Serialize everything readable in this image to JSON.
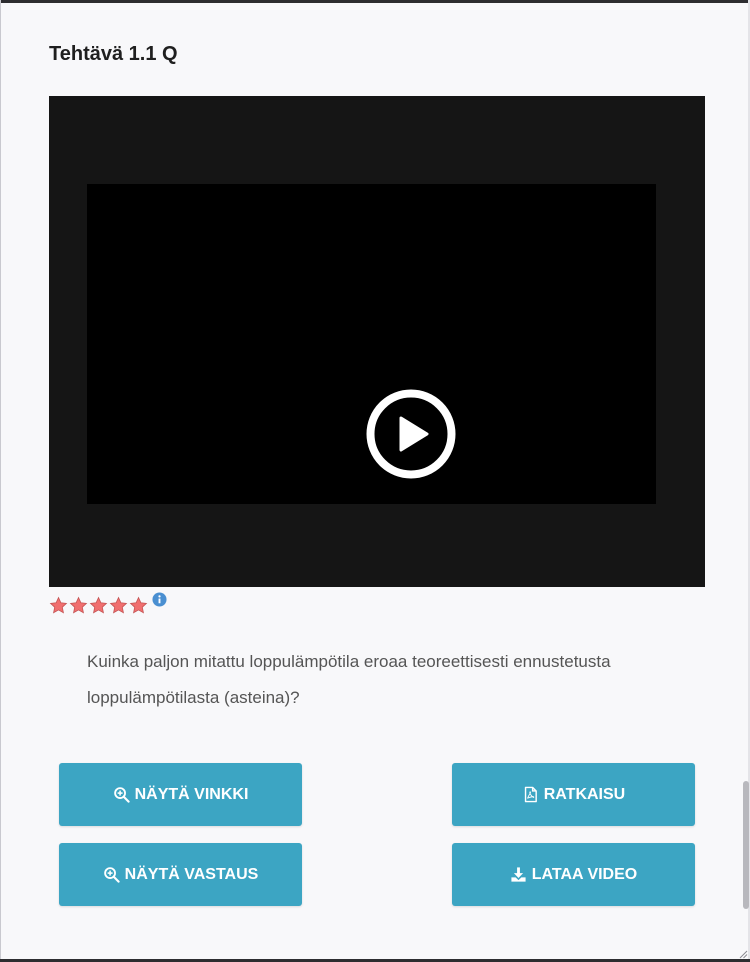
{
  "exercise": {
    "title": "Tehtävä 1.1 Q"
  },
  "video": {
    "play_icon": "play-circle-icon",
    "background_color": "#151515"
  },
  "rating": {
    "stars": 5,
    "max_stars": 5,
    "star_color": "#f06f6f",
    "info_icon": "info-icon"
  },
  "question": {
    "text": "Kuinka paljon mitattu loppulämpötila eroaa teoreettisesti ennustetusta loppulämpötilasta (asteina)?"
  },
  "buttons": {
    "hint": {
      "label": "NÄYTÄ VINKKI",
      "icon": "zoom-in-icon"
    },
    "solution": {
      "label": "RATKAISU",
      "icon": "pdf-file-icon"
    },
    "answer": {
      "label": "NÄYTÄ VASTAUS",
      "icon": "zoom-in-icon"
    },
    "download": {
      "label": "LATAA VIDEO",
      "icon": "download-icon"
    }
  },
  "colors": {
    "button": "#3ca5c3",
    "background": "#f8f8fa",
    "title": "#1f1f1f"
  }
}
